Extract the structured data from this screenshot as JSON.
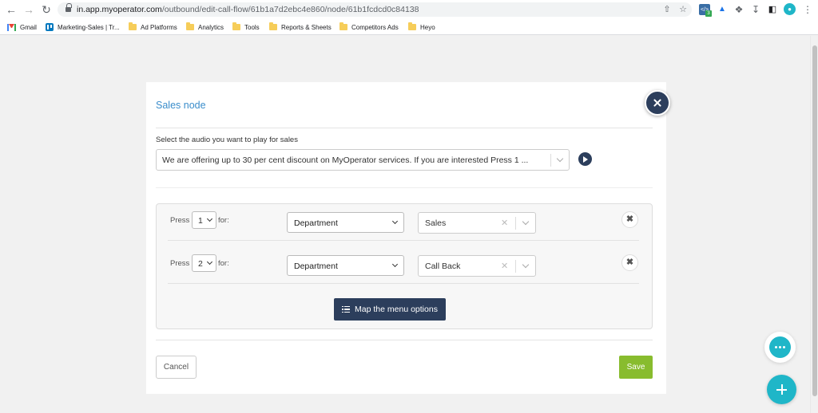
{
  "browser": {
    "url_host": "in.app.myoperator.com",
    "url_path": "/outbound/edit-call-flow/61b1a7d2ebc4e860/node/61b1fcdcd0c84138",
    "extension_badge": "3"
  },
  "bookmarks": [
    {
      "label": "Gmail",
      "icon": "gmail-icon"
    },
    {
      "label": "Marketing-Sales | Tr...",
      "icon": "trello-icon"
    },
    {
      "label": "Ad Platforms",
      "icon": "folder-icon"
    },
    {
      "label": "Analytics",
      "icon": "folder-icon"
    },
    {
      "label": "Tools",
      "icon": "folder-icon"
    },
    {
      "label": "Reports & Sheets",
      "icon": "folder-icon"
    },
    {
      "label": "Competitors Ads",
      "icon": "folder-icon"
    },
    {
      "label": "Heyo",
      "icon": "folder-icon"
    }
  ],
  "modal": {
    "title": "Sales node",
    "audio_label": "Select the audio you want to play for sales",
    "audio_value": "We are offering up to 30 per cent discount on MyOperator services. If you are interested Press 1 ...",
    "menu_rows": [
      {
        "press_label": "Press",
        "key": "1",
        "for_label": "for:",
        "type": "Department",
        "value": "Sales"
      },
      {
        "press_label": "Press",
        "key": "2",
        "for_label": "for:",
        "type": "Department",
        "value": "Call  Back"
      }
    ],
    "map_button": "Map the menu options",
    "cancel_button": "Cancel",
    "save_button": "Save"
  },
  "colors": {
    "primary": "#2c3e5c",
    "title": "#3a8dcb",
    "save": "#88bc2e",
    "fab": "#1fb6c8"
  }
}
